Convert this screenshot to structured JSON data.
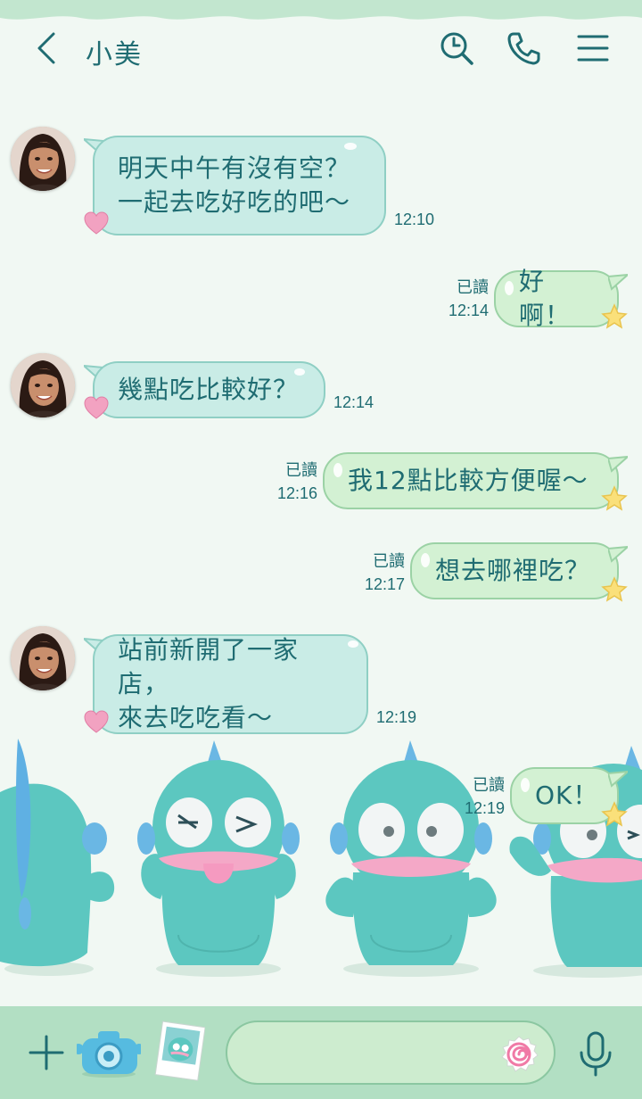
{
  "header": {
    "title": "小美",
    "back_icon": "chevron-left-icon",
    "icons": [
      "search-history-icon",
      "phone-icon",
      "menu-icon"
    ]
  },
  "messages": [
    {
      "side": "in",
      "text": "明天中午有沒有空？\n一起去吃好吃的吧〜",
      "time": "12:10"
    },
    {
      "side": "out",
      "text": "好啊！",
      "read": "已讀",
      "time": "12:14"
    },
    {
      "side": "in",
      "text": "幾點吃比較好？",
      "time": "12:14"
    },
    {
      "side": "out",
      "text": "我12點比較方便喔〜",
      "read": "已讀",
      "time": "12:16"
    },
    {
      "side": "out",
      "text": "想去哪裡吃？",
      "read": "已讀",
      "time": "12:17"
    },
    {
      "side": "in",
      "text": "站前新開了一家店，\n來去吃吃看〜",
      "time": "12:19"
    },
    {
      "side": "out",
      "text": "OK！",
      "read": "已讀",
      "time": "12:19"
    }
  ],
  "input": {
    "value": "",
    "icons": [
      "plus-icon",
      "camera-icon",
      "photo-icon",
      "emoji-icon",
      "mic-icon"
    ]
  },
  "colors": {
    "background": "#f1f8f3",
    "accent": "#1f6c72",
    "incoming_bubble": "#c9ece6",
    "outgoing_bubble": "#d3f1d3",
    "bottom_bar": "#b2dfc3",
    "mascot": "#5cc7c0"
  }
}
